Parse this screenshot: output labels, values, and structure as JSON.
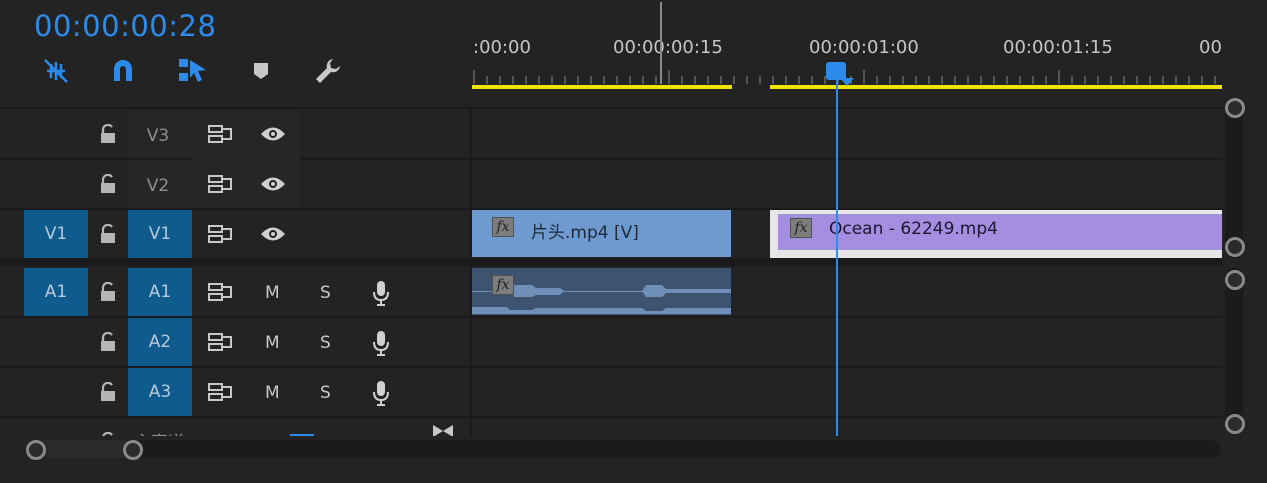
{
  "timecode": "00:00:00:28",
  "tools": [
    {
      "name": "snap-ripple-icon"
    },
    {
      "name": "magnet-icon"
    },
    {
      "name": "linked-selection-icon"
    },
    {
      "name": "add-marker-icon"
    },
    {
      "name": "wrench-icon"
    }
  ],
  "ruler": {
    "labels": [
      ":00:00",
      "00:00:00:15",
      "00:00:01:00",
      "00:00:01:15",
      "00"
    ]
  },
  "tracks": {
    "video": [
      {
        "source": "",
        "name": "V3",
        "targeted": false
      },
      {
        "source": "",
        "name": "V2",
        "targeted": false
      },
      {
        "source": "V1",
        "name": "V1",
        "targeted": true
      }
    ],
    "audio": [
      {
        "source": "A1",
        "name": "A1",
        "targeted": true,
        "m": "M",
        "s": "S"
      },
      {
        "source": "",
        "name": "A2",
        "targeted": true,
        "m": "M",
        "s": "S"
      },
      {
        "source": "",
        "name": "A3",
        "targeted": true,
        "m": "M",
        "s": "S"
      }
    ],
    "master_partial": "主声道"
  },
  "clips": {
    "video1": {
      "fx": "fx",
      "label": "片头.mp4 [V]",
      "color": "#6f9ad0"
    },
    "video2": {
      "fx": "fx",
      "label": "Ocean - 62249.mp4",
      "color": "#a48ee0"
    },
    "audio1": {
      "fx": "fx",
      "color": "#3e5370"
    }
  },
  "colors": {
    "accent": "#2d8ceb",
    "workarea": "#f2e500",
    "targeted": "#0f5b8e"
  }
}
